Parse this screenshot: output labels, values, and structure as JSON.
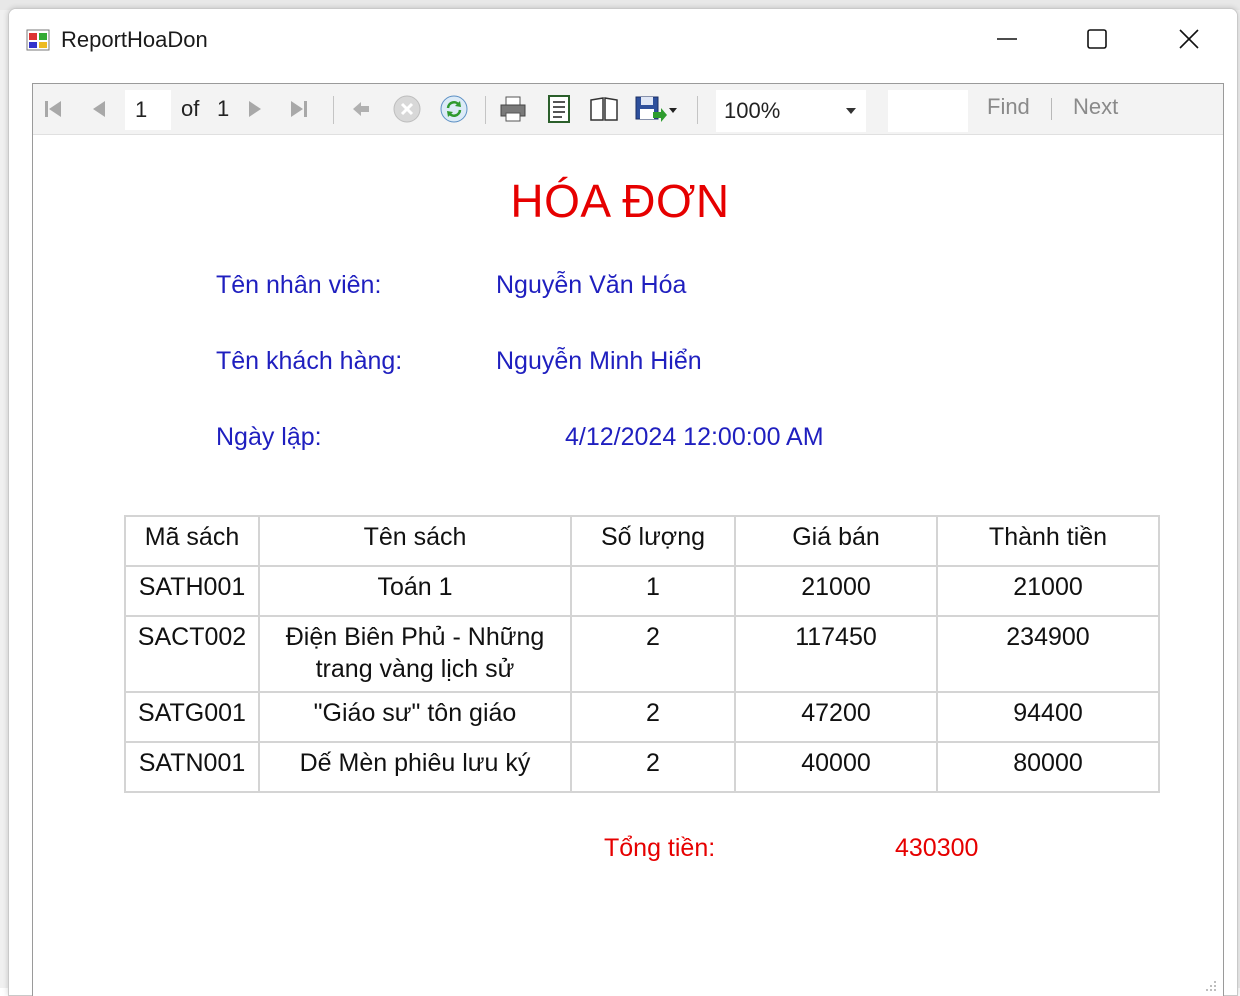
{
  "window": {
    "title": "ReportHoaDon"
  },
  "toolbar": {
    "current_page": "1",
    "of_label": "of",
    "total_pages": "1",
    "zoom": "100%",
    "find_label": "Find",
    "next_label": "Next"
  },
  "report": {
    "title": "HÓA ĐƠN",
    "employee_label": "Tên nhân viên:",
    "employee_value": "Nguyễn Văn Hóa",
    "customer_label": "Tên khách hàng:",
    "customer_value": "Nguyễn Minh Hiển",
    "date_label": "Ngày lập:",
    "date_value": "4/12/2024 12:00:00 AM",
    "columns": [
      "Mã sách",
      "Tên sách",
      "Số lượng",
      "Giá bán",
      "Thành tiền"
    ],
    "rows": [
      [
        "SATH001",
        "Toán 1",
        "1",
        "21000",
        "21000"
      ],
      [
        "SACT002",
        "Điện Biên Phủ - Những trang vàng lịch sử",
        "2",
        "117450",
        "234900"
      ],
      [
        "SATG001",
        "\"Giáo sư\" tôn giáo",
        "2",
        "47200",
        "94400"
      ],
      [
        "SATN001",
        "Dế Mèn phiêu lưu ký",
        "2",
        "40000",
        "80000"
      ]
    ],
    "total_label": "Tổng tiền:",
    "total_value": "430300"
  },
  "colors": {
    "title_red": "#e60000",
    "label_blue": "#1f1fbf",
    "grid": "#d4d4d4"
  }
}
